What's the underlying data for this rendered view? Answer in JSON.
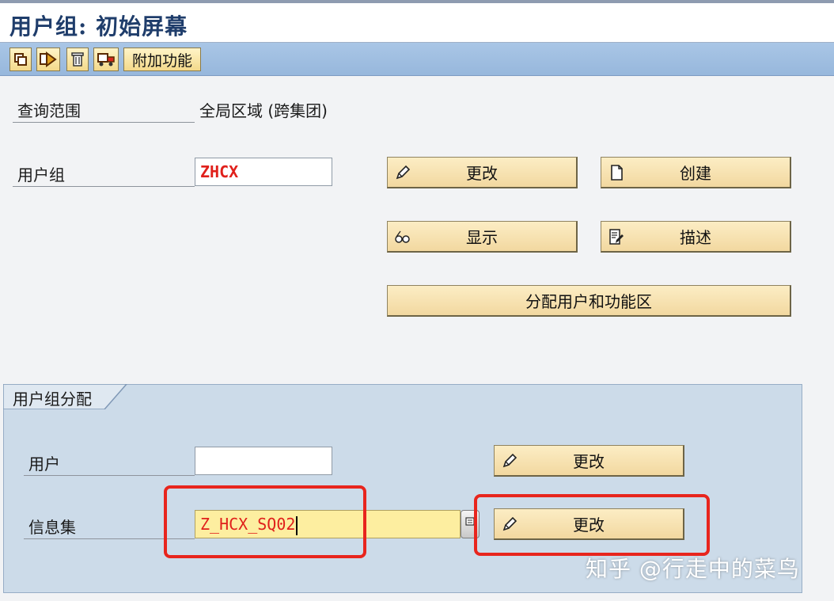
{
  "window": {
    "title": "用户组: 初始屏幕"
  },
  "toolbar": {
    "icons": [
      "copy-icon",
      "transfer-icon",
      "delete-icon",
      "transport-icon"
    ],
    "extras_label": "附加功能"
  },
  "form": {
    "query_scope_label": "查询范围",
    "query_scope_value": "全局区域 (跨集团)",
    "user_group_label": "用户组",
    "user_group_value": "ZHCX"
  },
  "actions": {
    "change": "更改",
    "create": "创建",
    "display": "显示",
    "describe": "描述",
    "assign": "分配用户和功能区"
  },
  "assignment": {
    "tab_label": "用户组分配",
    "user_label": "用户",
    "user_value": "",
    "infoset_label": "信息集",
    "infoset_value": "Z_HCX_SQ02",
    "change_user": "更改",
    "change_infoset": "更改"
  },
  "colors": {
    "highlight": "#e8251d",
    "field_value": "#e0201b",
    "button": "#f2d8a0"
  },
  "watermark": "知乎 @行走中的菜鸟"
}
